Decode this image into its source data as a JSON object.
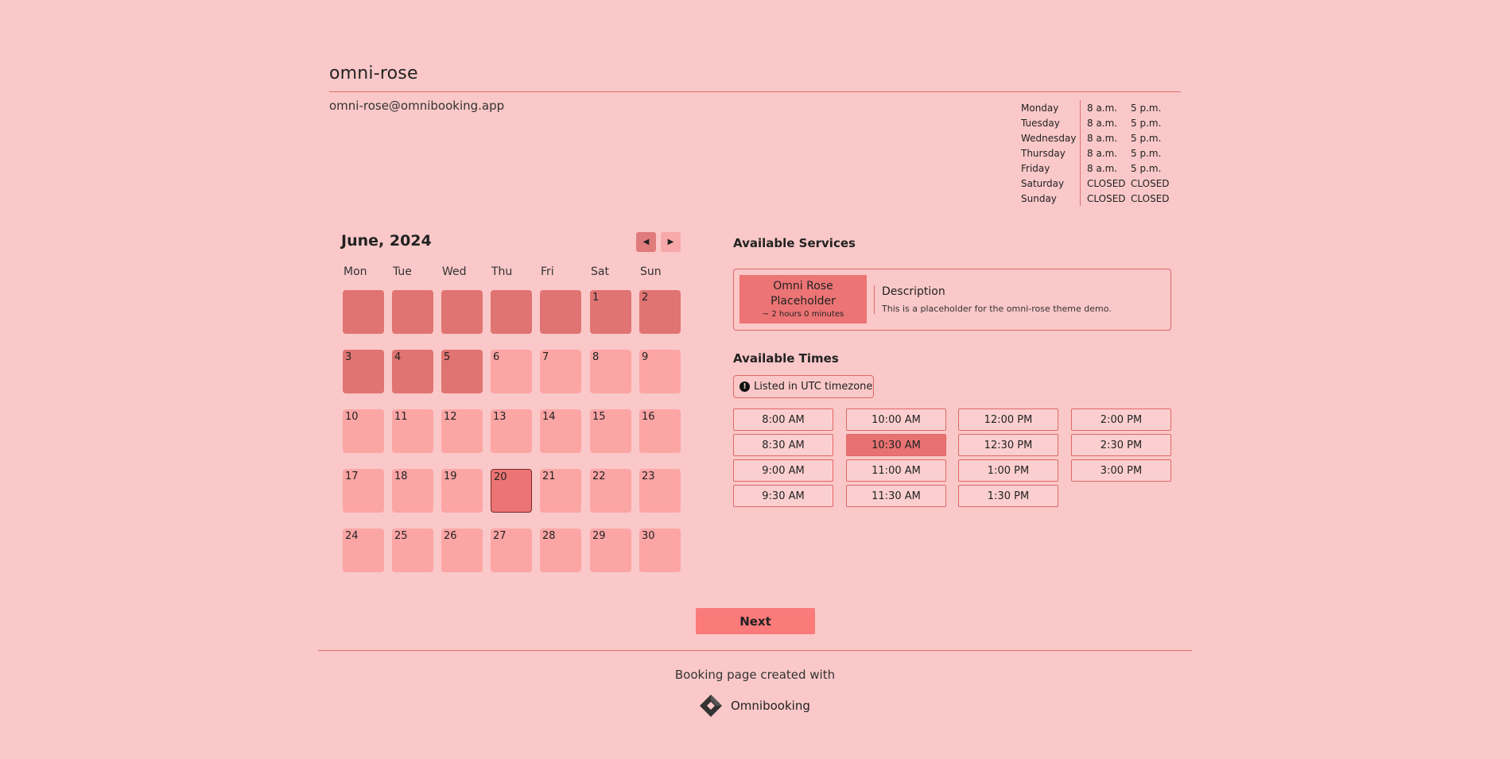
{
  "header": {
    "title": "omni-rose",
    "email": "omni-rose@omnibooking.app"
  },
  "hours": [
    {
      "day": "Monday",
      "open": "8 a.m.",
      "close": "5 p.m."
    },
    {
      "day": "Tuesday",
      "open": "8 a.m.",
      "close": "5 p.m."
    },
    {
      "day": "Wednesday",
      "open": "8 a.m.",
      "close": "5 p.m."
    },
    {
      "day": "Thursday",
      "open": "8 a.m.",
      "close": "5 p.m."
    },
    {
      "day": "Friday",
      "open": "8 a.m.",
      "close": "5 p.m."
    },
    {
      "day": "Saturday",
      "open": "CLOSED",
      "close": "CLOSED"
    },
    {
      "day": "Sunday",
      "open": "CLOSED",
      "close": "CLOSED"
    }
  ],
  "calendar": {
    "month_label": "June",
    "year_label": "2024",
    "weekdays": [
      "Mon",
      "Tue",
      "Wed",
      "Thu",
      "Fri",
      "Sat",
      "Sun"
    ],
    "leading_blanks": 5,
    "days_in_month": 30,
    "past_through": 5,
    "selected_day": 20
  },
  "services": {
    "heading": "Available Services",
    "name": "Omni Rose Placeholder",
    "duration": "~ 2 hours 0 minutes",
    "desc_heading": "Description",
    "desc_text": "This is a placeholder for the omni-rose theme demo."
  },
  "times": {
    "heading": "Available Times",
    "timezone_note": "Listed in UTC timezone",
    "columns": [
      [
        "8:00 AM",
        "8:30 AM",
        "9:00 AM",
        "9:30 AM"
      ],
      [
        "10:00 AM",
        "10:30 AM",
        "11:00 AM",
        "11:30 AM"
      ],
      [
        "12:00 PM",
        "12:30 PM",
        "1:00 PM",
        "1:30 PM"
      ],
      [
        "2:00 PM",
        "2:30 PM",
        "3:00 PM"
      ]
    ],
    "selected": "10:30 AM"
  },
  "actions": {
    "next_label": "Next"
  },
  "footer": {
    "text": "Booking page created with",
    "brand": "Omnibooking"
  },
  "colors": {
    "background": "#fac8c8",
    "accent": "#e07070",
    "past_day": "#e07472",
    "available_day": "#fca5a5",
    "selected": "#ec7474",
    "next_button": "#fb7a7a"
  }
}
